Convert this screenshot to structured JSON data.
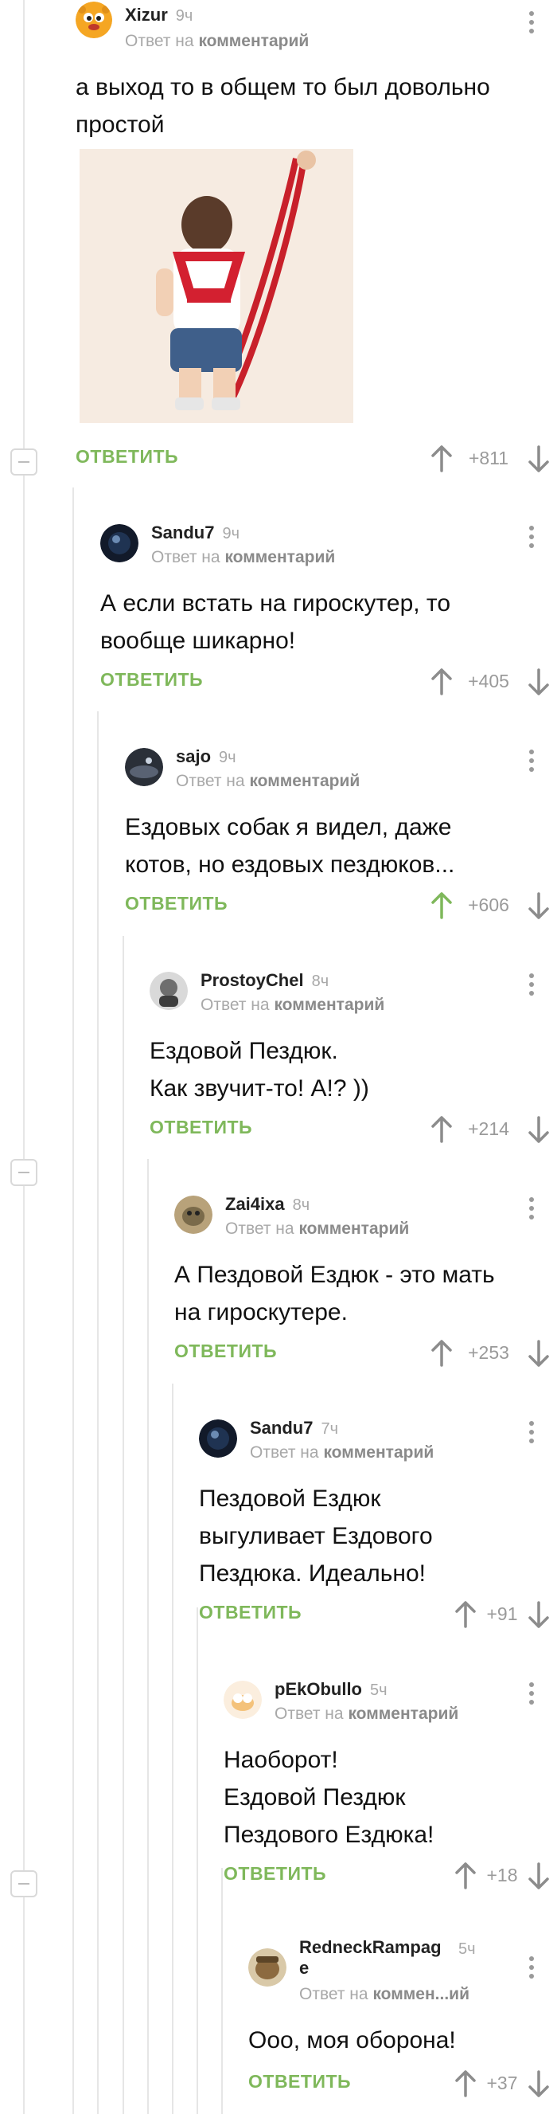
{
  "labels": {
    "reply_prefix": "Ответ на",
    "reply_target": "комментарий",
    "reply_target_truncated": "коммен...ий",
    "answer_button": "ОТВЕТИТЬ"
  },
  "comments": [
    {
      "author": "Xizur",
      "time": "9ч",
      "lines": [
        "а выход то в общем то был довольно",
        "простой"
      ],
      "score": "+811",
      "has_image": true,
      "upvoted": false
    },
    {
      "author": "Sandu7",
      "time": "9ч",
      "lines": [
        "А если встать на гироскутер, то",
        "вообще шикарно!"
      ],
      "score": "+405",
      "upvoted": false
    },
    {
      "author": "sajo",
      "time": "9ч",
      "lines": [
        "Ездовых собак я видел, даже",
        "котов, но ездовых пездюков..."
      ],
      "score": "+606",
      "upvoted": true
    },
    {
      "author": "ProstoyChel",
      "time": "8ч",
      "lines": [
        "Ездовой Пездюк.",
        "Как звучит-то! А!? ))"
      ],
      "score": "+214",
      "upvoted": false
    },
    {
      "author": "Zai4ixa",
      "time": "8ч",
      "lines": [
        "А Пездовой Ездюк - это мать",
        "на гироскутере."
      ],
      "score": "+253",
      "upvoted": false
    },
    {
      "author": "Sandu7",
      "time": "7ч",
      "lines": [
        "Пездовой Ездюк",
        "выгуливает Ездового",
        "Пездюка. Идеально!"
      ],
      "score": "+91",
      "upvoted": false
    },
    {
      "author": "pEkObullo",
      "time": "5ч",
      "lines": [
        "Наоборот!",
        "Ездовой Пездюк",
        "Пездового Ездюка!"
      ],
      "score": "+18",
      "upvoted": false
    },
    {
      "author_line1": "RedneckRampag",
      "author_line2": "e",
      "time": "5ч",
      "lines": [
        "Ооо, моя оборона!"
      ],
      "score": "+37",
      "upvoted": false
    }
  ],
  "colors": {
    "accent_green": "#7fb85b",
    "muted_gray": "#9a9a9a"
  }
}
